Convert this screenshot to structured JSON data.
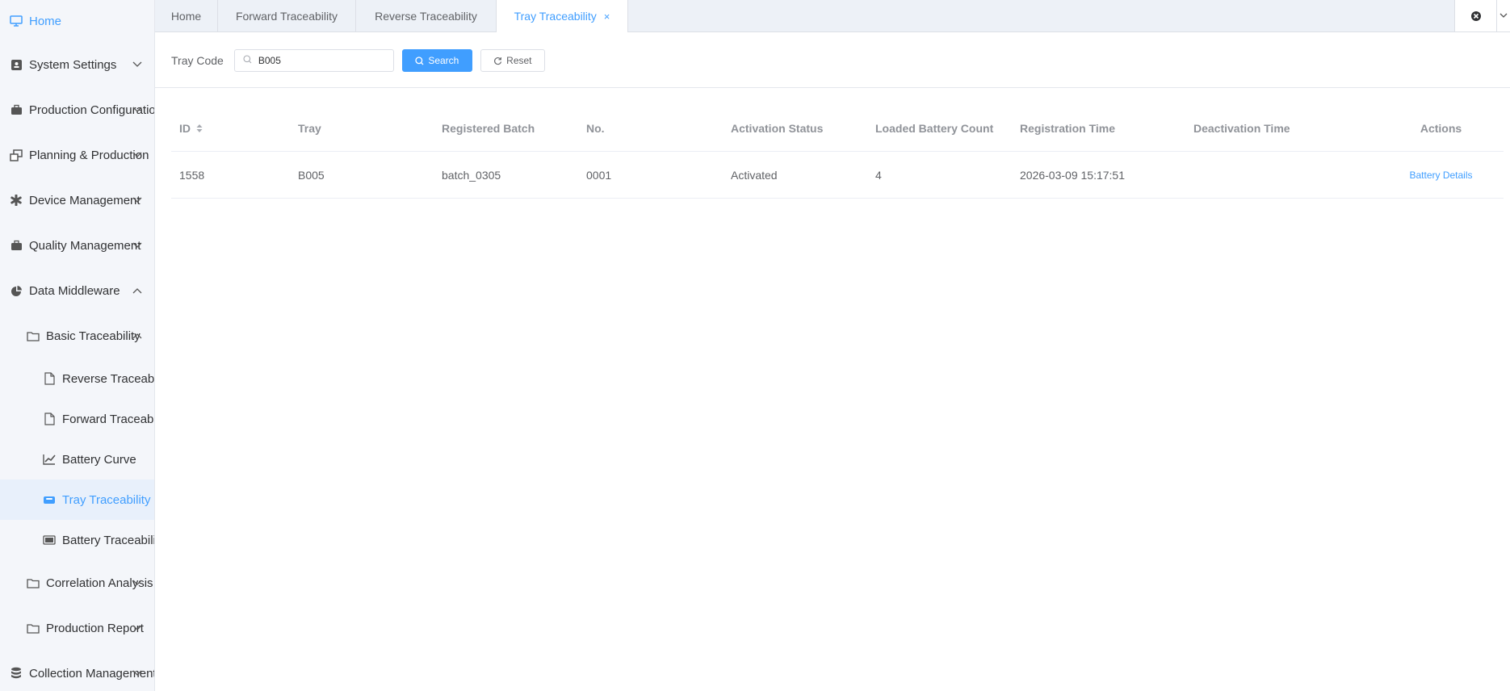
{
  "sidebar": {
    "home": "Home",
    "system_settings": "System Settings",
    "production_configuration": "Production Configuration",
    "planning_production": "Planning & Production",
    "device_management": "Device Management",
    "quality_management": "Quality Management",
    "data_middleware": "Data Middleware",
    "basic_traceability": "Basic Traceability",
    "reverse_traceability": "Reverse Traceability",
    "forward_traceability": "Forward Traceability",
    "battery_curve": "Battery Curve",
    "tray_traceability": "Tray Traceability",
    "battery_traceability": "Battery Traceability",
    "correlation_analysis": "Correlation Analysis",
    "production_report": "Production Report",
    "collection_management": "Collection Management"
  },
  "tabs": [
    "Home",
    "Forward Traceability",
    "Reverse Traceability",
    "Tray Traceability"
  ],
  "search": {
    "label": "Tray Code",
    "value": "B005",
    "search_button": "Search",
    "reset_button": "Reset"
  },
  "table": {
    "columns": [
      "ID",
      "Tray",
      "Registered Batch",
      "No.",
      "Activation Status",
      "Loaded Battery Count",
      "Registration Time",
      "Deactivation Time",
      "Actions"
    ],
    "rows": [
      {
        "id": "1558",
        "tray": "B005",
        "batch": "batch_0305",
        "no": "0001",
        "status": "Activated",
        "count": "4",
        "registration_time": "2026-03-09 15:17:51",
        "deactivation_time": "",
        "action": "Battery Details"
      }
    ]
  },
  "colors": {
    "accent": "#409eff"
  }
}
